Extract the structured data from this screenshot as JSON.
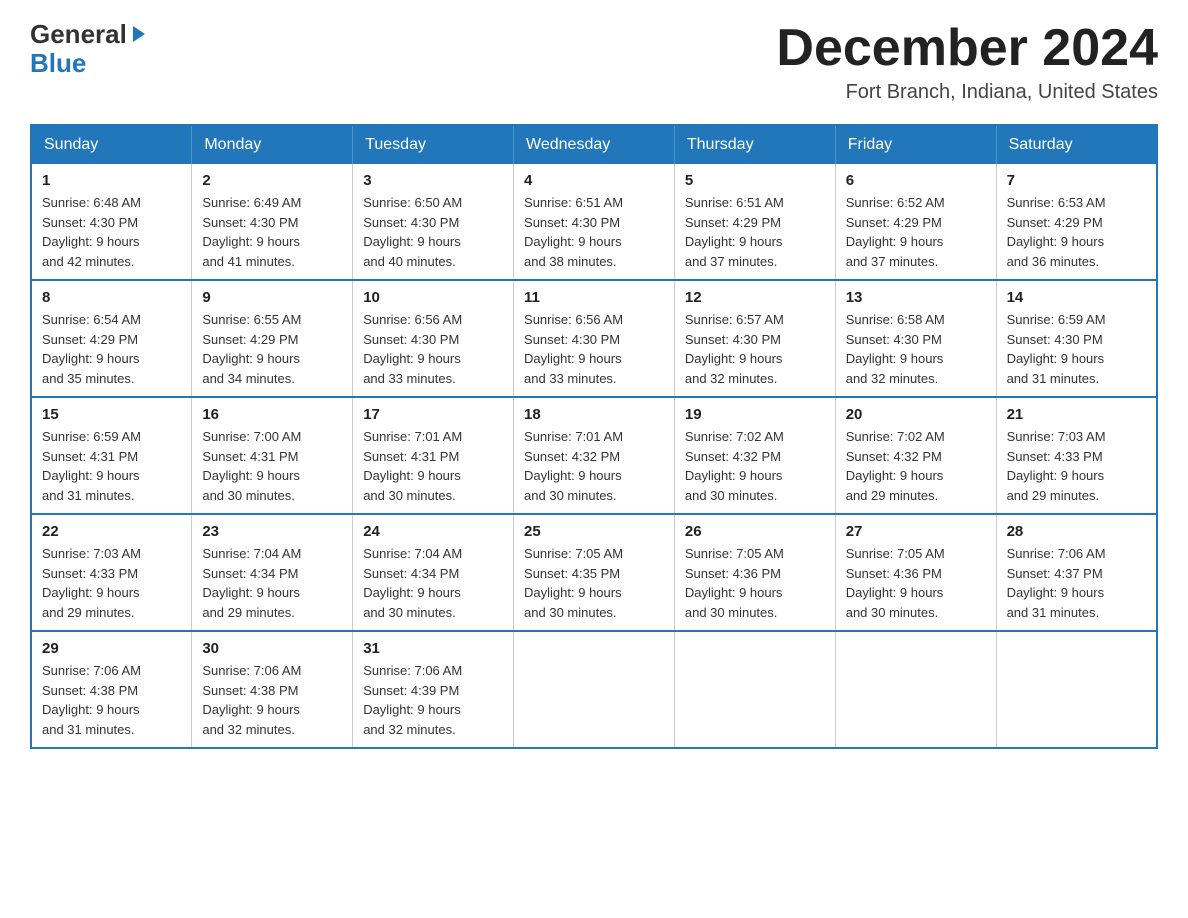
{
  "logo": {
    "general": "General",
    "blue": "Blue"
  },
  "title": {
    "month_year": "December 2024",
    "location": "Fort Branch, Indiana, United States"
  },
  "weekdays": [
    "Sunday",
    "Monday",
    "Tuesday",
    "Wednesday",
    "Thursday",
    "Friday",
    "Saturday"
  ],
  "weeks": [
    [
      {
        "day": "1",
        "sunrise": "6:48 AM",
        "sunset": "4:30 PM",
        "daylight": "9 hours and 42 minutes."
      },
      {
        "day": "2",
        "sunrise": "6:49 AM",
        "sunset": "4:30 PM",
        "daylight": "9 hours and 41 minutes."
      },
      {
        "day": "3",
        "sunrise": "6:50 AM",
        "sunset": "4:30 PM",
        "daylight": "9 hours and 40 minutes."
      },
      {
        "day": "4",
        "sunrise": "6:51 AM",
        "sunset": "4:30 PM",
        "daylight": "9 hours and 38 minutes."
      },
      {
        "day": "5",
        "sunrise": "6:51 AM",
        "sunset": "4:29 PM",
        "daylight": "9 hours and 37 minutes."
      },
      {
        "day": "6",
        "sunrise": "6:52 AM",
        "sunset": "4:29 PM",
        "daylight": "9 hours and 37 minutes."
      },
      {
        "day": "7",
        "sunrise": "6:53 AM",
        "sunset": "4:29 PM",
        "daylight": "9 hours and 36 minutes."
      }
    ],
    [
      {
        "day": "8",
        "sunrise": "6:54 AM",
        "sunset": "4:29 PM",
        "daylight": "9 hours and 35 minutes."
      },
      {
        "day": "9",
        "sunrise": "6:55 AM",
        "sunset": "4:29 PM",
        "daylight": "9 hours and 34 minutes."
      },
      {
        "day": "10",
        "sunrise": "6:56 AM",
        "sunset": "4:30 PM",
        "daylight": "9 hours and 33 minutes."
      },
      {
        "day": "11",
        "sunrise": "6:56 AM",
        "sunset": "4:30 PM",
        "daylight": "9 hours and 33 minutes."
      },
      {
        "day": "12",
        "sunrise": "6:57 AM",
        "sunset": "4:30 PM",
        "daylight": "9 hours and 32 minutes."
      },
      {
        "day": "13",
        "sunrise": "6:58 AM",
        "sunset": "4:30 PM",
        "daylight": "9 hours and 32 minutes."
      },
      {
        "day": "14",
        "sunrise": "6:59 AM",
        "sunset": "4:30 PM",
        "daylight": "9 hours and 31 minutes."
      }
    ],
    [
      {
        "day": "15",
        "sunrise": "6:59 AM",
        "sunset": "4:31 PM",
        "daylight": "9 hours and 31 minutes."
      },
      {
        "day": "16",
        "sunrise": "7:00 AM",
        "sunset": "4:31 PM",
        "daylight": "9 hours and 30 minutes."
      },
      {
        "day": "17",
        "sunrise": "7:01 AM",
        "sunset": "4:31 PM",
        "daylight": "9 hours and 30 minutes."
      },
      {
        "day": "18",
        "sunrise": "7:01 AM",
        "sunset": "4:32 PM",
        "daylight": "9 hours and 30 minutes."
      },
      {
        "day": "19",
        "sunrise": "7:02 AM",
        "sunset": "4:32 PM",
        "daylight": "9 hours and 30 minutes."
      },
      {
        "day": "20",
        "sunrise": "7:02 AM",
        "sunset": "4:32 PM",
        "daylight": "9 hours and 29 minutes."
      },
      {
        "day": "21",
        "sunrise": "7:03 AM",
        "sunset": "4:33 PM",
        "daylight": "9 hours and 29 minutes."
      }
    ],
    [
      {
        "day": "22",
        "sunrise": "7:03 AM",
        "sunset": "4:33 PM",
        "daylight": "9 hours and 29 minutes."
      },
      {
        "day": "23",
        "sunrise": "7:04 AM",
        "sunset": "4:34 PM",
        "daylight": "9 hours and 29 minutes."
      },
      {
        "day": "24",
        "sunrise": "7:04 AM",
        "sunset": "4:34 PM",
        "daylight": "9 hours and 30 minutes."
      },
      {
        "day": "25",
        "sunrise": "7:05 AM",
        "sunset": "4:35 PM",
        "daylight": "9 hours and 30 minutes."
      },
      {
        "day": "26",
        "sunrise": "7:05 AM",
        "sunset": "4:36 PM",
        "daylight": "9 hours and 30 minutes."
      },
      {
        "day": "27",
        "sunrise": "7:05 AM",
        "sunset": "4:36 PM",
        "daylight": "9 hours and 30 minutes."
      },
      {
        "day": "28",
        "sunrise": "7:06 AM",
        "sunset": "4:37 PM",
        "daylight": "9 hours and 31 minutes."
      }
    ],
    [
      {
        "day": "29",
        "sunrise": "7:06 AM",
        "sunset": "4:38 PM",
        "daylight": "9 hours and 31 minutes."
      },
      {
        "day": "30",
        "sunrise": "7:06 AM",
        "sunset": "4:38 PM",
        "daylight": "9 hours and 32 minutes."
      },
      {
        "day": "31",
        "sunrise": "7:06 AM",
        "sunset": "4:39 PM",
        "daylight": "9 hours and 32 minutes."
      },
      null,
      null,
      null,
      null
    ]
  ],
  "labels": {
    "sunrise": "Sunrise:",
    "sunset": "Sunset:",
    "daylight": "Daylight:"
  }
}
